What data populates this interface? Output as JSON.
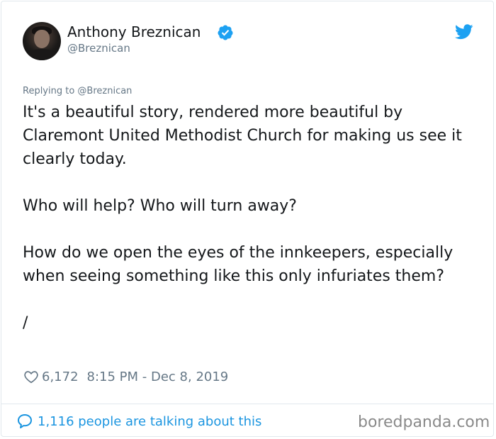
{
  "tweet": {
    "author_name": "Anthony Breznican",
    "handle": "@Breznican",
    "replying_to": "Replying to @Breznican",
    "paragraphs": [
      "It's a beautiful story, rendered more beautiful by Claremont United Methodist Church for making us see it clearly today.",
      "Who will help? Who will turn away?",
      "How do we open the eyes of the innkeepers, especially when seeing something like this only infuriates them?",
      "/"
    ],
    "likes": "6,172",
    "timestamp": "8:15 PM - Dec 8, 2019",
    "conversation_text": "1,116 people are talking about this"
  },
  "watermark": "boredpanda.com",
  "icons": {
    "verified": "verified-badge-icon",
    "twitter": "twitter-bird-icon",
    "like": "heart-icon",
    "conversation": "speech-bubble-icon"
  },
  "colors": {
    "text": "#14171a",
    "secondary": "#657786",
    "accent": "#1b95e0",
    "twitter_blue": "#1da1f2"
  }
}
